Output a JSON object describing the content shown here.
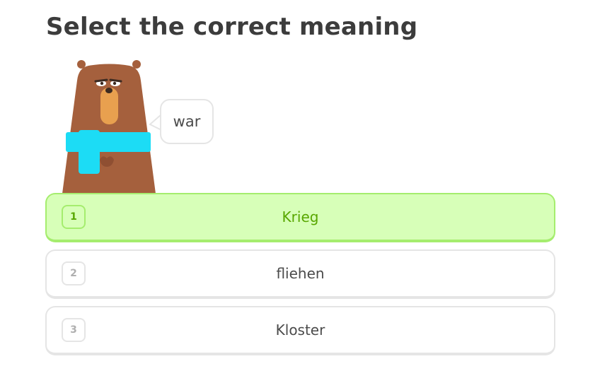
{
  "prompt": {
    "title": "Select the correct meaning"
  },
  "speech_bubble": {
    "text": "war"
  },
  "options": [
    {
      "number": "1",
      "label": "Krieg",
      "selected": true
    },
    {
      "number": "2",
      "label": "fliehen",
      "selected": false
    },
    {
      "number": "3",
      "label": "Kloster",
      "selected": false
    }
  ],
  "colors": {
    "selected_background": "#d7ffb8",
    "selected_border": "#a5ed6e",
    "selected_text": "#58a700",
    "default_border": "#e5e5e5",
    "title_text": "#3c3c3c",
    "bear_fur": "#a5603d",
    "bear_muzzle": "#e8a04f",
    "scarf": "#1cdcf5"
  }
}
